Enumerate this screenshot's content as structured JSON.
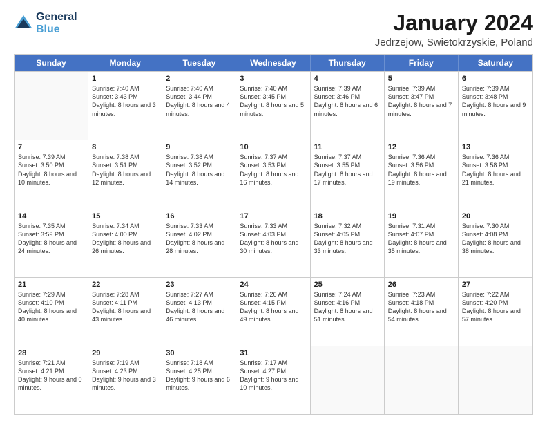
{
  "header": {
    "logo_line1": "General",
    "logo_line2": "Blue",
    "title": "January 2024",
    "subtitle": "Jedrzejow, Swietokrzyskie, Poland"
  },
  "calendar": {
    "days_of_week": [
      "Sunday",
      "Monday",
      "Tuesday",
      "Wednesday",
      "Thursday",
      "Friday",
      "Saturday"
    ],
    "weeks": [
      [
        {
          "day": "",
          "empty": true
        },
        {
          "day": "1",
          "sunrise": "Sunrise: 7:40 AM",
          "sunset": "Sunset: 3:43 PM",
          "daylight": "Daylight: 8 hours and 3 minutes."
        },
        {
          "day": "2",
          "sunrise": "Sunrise: 7:40 AM",
          "sunset": "Sunset: 3:44 PM",
          "daylight": "Daylight: 8 hours and 4 minutes."
        },
        {
          "day": "3",
          "sunrise": "Sunrise: 7:40 AM",
          "sunset": "Sunset: 3:45 PM",
          "daylight": "Daylight: 8 hours and 5 minutes."
        },
        {
          "day": "4",
          "sunrise": "Sunrise: 7:39 AM",
          "sunset": "Sunset: 3:46 PM",
          "daylight": "Daylight: 8 hours and 6 minutes."
        },
        {
          "day": "5",
          "sunrise": "Sunrise: 7:39 AM",
          "sunset": "Sunset: 3:47 PM",
          "daylight": "Daylight: 8 hours and 7 minutes."
        },
        {
          "day": "6",
          "sunrise": "Sunrise: 7:39 AM",
          "sunset": "Sunset: 3:48 PM",
          "daylight": "Daylight: 8 hours and 9 minutes."
        }
      ],
      [
        {
          "day": "7",
          "sunrise": "Sunrise: 7:39 AM",
          "sunset": "Sunset: 3:50 PM",
          "daylight": "Daylight: 8 hours and 10 minutes."
        },
        {
          "day": "8",
          "sunrise": "Sunrise: 7:38 AM",
          "sunset": "Sunset: 3:51 PM",
          "daylight": "Daylight: 8 hours and 12 minutes."
        },
        {
          "day": "9",
          "sunrise": "Sunrise: 7:38 AM",
          "sunset": "Sunset: 3:52 PM",
          "daylight": "Daylight: 8 hours and 14 minutes."
        },
        {
          "day": "10",
          "sunrise": "Sunrise: 7:37 AM",
          "sunset": "Sunset: 3:53 PM",
          "daylight": "Daylight: 8 hours and 16 minutes."
        },
        {
          "day": "11",
          "sunrise": "Sunrise: 7:37 AM",
          "sunset": "Sunset: 3:55 PM",
          "daylight": "Daylight: 8 hours and 17 minutes."
        },
        {
          "day": "12",
          "sunrise": "Sunrise: 7:36 AM",
          "sunset": "Sunset: 3:56 PM",
          "daylight": "Daylight: 8 hours and 19 minutes."
        },
        {
          "day": "13",
          "sunrise": "Sunrise: 7:36 AM",
          "sunset": "Sunset: 3:58 PM",
          "daylight": "Daylight: 8 hours and 21 minutes."
        }
      ],
      [
        {
          "day": "14",
          "sunrise": "Sunrise: 7:35 AM",
          "sunset": "Sunset: 3:59 PM",
          "daylight": "Daylight: 8 hours and 24 minutes."
        },
        {
          "day": "15",
          "sunrise": "Sunrise: 7:34 AM",
          "sunset": "Sunset: 4:00 PM",
          "daylight": "Daylight: 8 hours and 26 minutes."
        },
        {
          "day": "16",
          "sunrise": "Sunrise: 7:33 AM",
          "sunset": "Sunset: 4:02 PM",
          "daylight": "Daylight: 8 hours and 28 minutes."
        },
        {
          "day": "17",
          "sunrise": "Sunrise: 7:33 AM",
          "sunset": "Sunset: 4:03 PM",
          "daylight": "Daylight: 8 hours and 30 minutes."
        },
        {
          "day": "18",
          "sunrise": "Sunrise: 7:32 AM",
          "sunset": "Sunset: 4:05 PM",
          "daylight": "Daylight: 8 hours and 33 minutes."
        },
        {
          "day": "19",
          "sunrise": "Sunrise: 7:31 AM",
          "sunset": "Sunset: 4:07 PM",
          "daylight": "Daylight: 8 hours and 35 minutes."
        },
        {
          "day": "20",
          "sunrise": "Sunrise: 7:30 AM",
          "sunset": "Sunset: 4:08 PM",
          "daylight": "Daylight: 8 hours and 38 minutes."
        }
      ],
      [
        {
          "day": "21",
          "sunrise": "Sunrise: 7:29 AM",
          "sunset": "Sunset: 4:10 PM",
          "daylight": "Daylight: 8 hours and 40 minutes."
        },
        {
          "day": "22",
          "sunrise": "Sunrise: 7:28 AM",
          "sunset": "Sunset: 4:11 PM",
          "daylight": "Daylight: 8 hours and 43 minutes."
        },
        {
          "day": "23",
          "sunrise": "Sunrise: 7:27 AM",
          "sunset": "Sunset: 4:13 PM",
          "daylight": "Daylight: 8 hours and 46 minutes."
        },
        {
          "day": "24",
          "sunrise": "Sunrise: 7:26 AM",
          "sunset": "Sunset: 4:15 PM",
          "daylight": "Daylight: 8 hours and 49 minutes."
        },
        {
          "day": "25",
          "sunrise": "Sunrise: 7:24 AM",
          "sunset": "Sunset: 4:16 PM",
          "daylight": "Daylight: 8 hours and 51 minutes."
        },
        {
          "day": "26",
          "sunrise": "Sunrise: 7:23 AM",
          "sunset": "Sunset: 4:18 PM",
          "daylight": "Daylight: 8 hours and 54 minutes."
        },
        {
          "day": "27",
          "sunrise": "Sunrise: 7:22 AM",
          "sunset": "Sunset: 4:20 PM",
          "daylight": "Daylight: 8 hours and 57 minutes."
        }
      ],
      [
        {
          "day": "28",
          "sunrise": "Sunrise: 7:21 AM",
          "sunset": "Sunset: 4:21 PM",
          "daylight": "Daylight: 9 hours and 0 minutes."
        },
        {
          "day": "29",
          "sunrise": "Sunrise: 7:19 AM",
          "sunset": "Sunset: 4:23 PM",
          "daylight": "Daylight: 9 hours and 3 minutes."
        },
        {
          "day": "30",
          "sunrise": "Sunrise: 7:18 AM",
          "sunset": "Sunset: 4:25 PM",
          "daylight": "Daylight: 9 hours and 6 minutes."
        },
        {
          "day": "31",
          "sunrise": "Sunrise: 7:17 AM",
          "sunset": "Sunset: 4:27 PM",
          "daylight": "Daylight: 9 hours and 10 minutes."
        },
        {
          "day": "",
          "empty": true
        },
        {
          "day": "",
          "empty": true
        },
        {
          "day": "",
          "empty": true
        }
      ]
    ]
  }
}
